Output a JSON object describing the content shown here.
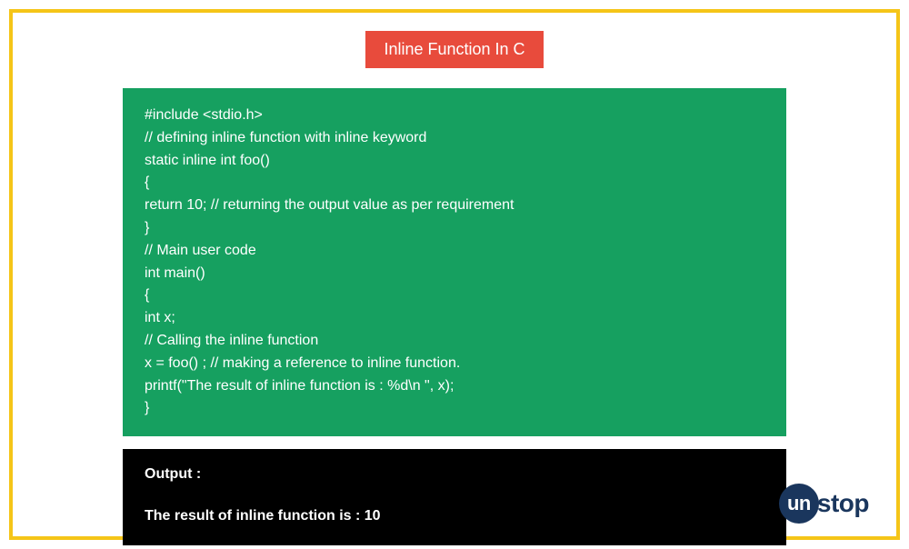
{
  "title": "Inline Function In C",
  "code": {
    "lines": [
      "#include <stdio.h>",
      "// defining inline function with inline keyword",
      "static inline int foo()",
      "{",
      "return 10; // returning the output value as per requirement",
      "}",
      "// Main user code",
      "int main()",
      "{",
      "int x;",
      "// Calling the inline function",
      "x = foo() ; // making a reference to inline function.",
      "printf(\"The result of inline function is : %d\\n \", x);",
      "}"
    ]
  },
  "output": {
    "label": "Output :",
    "text": "The result of inline function is : 10"
  },
  "brand": {
    "prefix": "un",
    "suffix": "stop"
  }
}
